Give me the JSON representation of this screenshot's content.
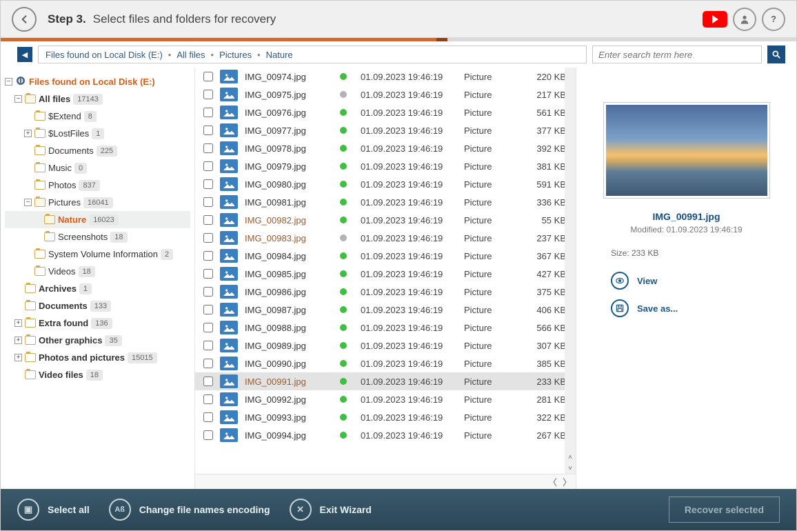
{
  "header": {
    "step": "Step 3.",
    "desc": "Select files and folders for recovery"
  },
  "breadcrumb": [
    "Files found on Local Disk (E:)",
    "All files",
    "Pictures",
    "Nature"
  ],
  "search": {
    "placeholder": "Enter search term here"
  },
  "tree": [
    {
      "level": 0,
      "exp": "-",
      "label": "Files found on Local Disk (E:)",
      "root": true,
      "icon": "disk"
    },
    {
      "level": 1,
      "exp": "-",
      "label": "All files",
      "bold": true,
      "count": "17143"
    },
    {
      "level": 2,
      "exp": "",
      "label": "$Extend",
      "count": "8"
    },
    {
      "level": 2,
      "exp": "+",
      "label": "$LostFiles",
      "count": "1"
    },
    {
      "level": 2,
      "exp": "",
      "label": "Documents",
      "count": "225"
    },
    {
      "level": 2,
      "exp": "",
      "label": "Music",
      "count": "0"
    },
    {
      "level": 2,
      "exp": "",
      "label": "Photos",
      "count": "837"
    },
    {
      "level": 2,
      "exp": "-",
      "label": "Pictures",
      "count": "16041"
    },
    {
      "level": 3,
      "exp": "",
      "label": "Nature",
      "count": "16023",
      "sel": true
    },
    {
      "level": 3,
      "exp": "",
      "label": "Screenshots",
      "count": "18"
    },
    {
      "level": 2,
      "exp": "",
      "label": "System Volume Information",
      "count": "2"
    },
    {
      "level": 2,
      "exp": "",
      "label": "Videos",
      "count": "18"
    },
    {
      "level": 1,
      "exp": "",
      "label": "Archives",
      "bold": true,
      "count": "1"
    },
    {
      "level": 1,
      "exp": "",
      "label": "Documents",
      "bold": true,
      "count": "133"
    },
    {
      "level": 1,
      "exp": "+",
      "label": "Extra found",
      "bold": true,
      "count": "136"
    },
    {
      "level": 1,
      "exp": "+",
      "label": "Other graphics",
      "bold": true,
      "count": "35"
    },
    {
      "level": 1,
      "exp": "+",
      "label": "Photos and pictures",
      "bold": true,
      "count": "15015"
    },
    {
      "level": 1,
      "exp": "",
      "label": "Video files",
      "bold": true,
      "count": "18"
    }
  ],
  "files": [
    {
      "name": "IMG_00974.jpg",
      "date": "01.09.2023 19:46:19",
      "type": "Picture",
      "size": "220 KB",
      "status": "green"
    },
    {
      "name": "IMG_00975.jpg",
      "date": "01.09.2023 19:46:19",
      "type": "Picture",
      "size": "217 KB",
      "status": "gray"
    },
    {
      "name": "IMG_00976.jpg",
      "date": "01.09.2023 19:46:19",
      "type": "Picture",
      "size": "561 KB",
      "status": "green"
    },
    {
      "name": "IMG_00977.jpg",
      "date": "01.09.2023 19:46:19",
      "type": "Picture",
      "size": "377 KB",
      "status": "green"
    },
    {
      "name": "IMG_00978.jpg",
      "date": "01.09.2023 19:46:19",
      "type": "Picture",
      "size": "392 KB",
      "status": "green"
    },
    {
      "name": "IMG_00979.jpg",
      "date": "01.09.2023 19:46:19",
      "type": "Picture",
      "size": "381 KB",
      "status": "green"
    },
    {
      "name": "IMG_00980.jpg",
      "date": "01.09.2023 19:46:19",
      "type": "Picture",
      "size": "591 KB",
      "status": "green"
    },
    {
      "name": "IMG_00981.jpg",
      "date": "01.09.2023 19:46:19",
      "type": "Picture",
      "size": "336 KB",
      "status": "green"
    },
    {
      "name": "IMG_00982.jpg",
      "date": "01.09.2023 19:46:19",
      "type": "Picture",
      "size": "55 KB",
      "status": "green",
      "brown": true
    },
    {
      "name": "IMG_00983.jpg",
      "date": "01.09.2023 19:46:19",
      "type": "Picture",
      "size": "237 KB",
      "status": "gray",
      "brown": true
    },
    {
      "name": "IMG_00984.jpg",
      "date": "01.09.2023 19:46:19",
      "type": "Picture",
      "size": "367 KB",
      "status": "green"
    },
    {
      "name": "IMG_00985.jpg",
      "date": "01.09.2023 19:46:19",
      "type": "Picture",
      "size": "427 KB",
      "status": "green"
    },
    {
      "name": "IMG_00986.jpg",
      "date": "01.09.2023 19:46:19",
      "type": "Picture",
      "size": "375 KB",
      "status": "green"
    },
    {
      "name": "IMG_00987.jpg",
      "date": "01.09.2023 19:46:19",
      "type": "Picture",
      "size": "406 KB",
      "status": "green"
    },
    {
      "name": "IMG_00988.jpg",
      "date": "01.09.2023 19:46:19",
      "type": "Picture",
      "size": "566 KB",
      "status": "green"
    },
    {
      "name": "IMG_00989.jpg",
      "date": "01.09.2023 19:46:19",
      "type": "Picture",
      "size": "307 KB",
      "status": "green"
    },
    {
      "name": "IMG_00990.jpg",
      "date": "01.09.2023 19:46:19",
      "type": "Picture",
      "size": "385 KB",
      "status": "green"
    },
    {
      "name": "IMG_00991.jpg",
      "date": "01.09.2023 19:46:19",
      "type": "Picture",
      "size": "233 KB",
      "status": "green",
      "sel": true,
      "brown": true
    },
    {
      "name": "IMG_00992.jpg",
      "date": "01.09.2023 19:46:19",
      "type": "Picture",
      "size": "281 KB",
      "status": "green"
    },
    {
      "name": "IMG_00993.jpg",
      "date": "01.09.2023 19:46:19",
      "type": "Picture",
      "size": "322 KB",
      "status": "green"
    },
    {
      "name": "IMG_00994.jpg",
      "date": "01.09.2023 19:46:19",
      "type": "Picture",
      "size": "267 KB",
      "status": "green"
    }
  ],
  "preview": {
    "name": "IMG_00991.jpg",
    "modified": "Modified: 01.09.2023 19:46:19",
    "size": "Size: 233 KB",
    "view": "View",
    "saveas": "Save as..."
  },
  "footer": {
    "selectall": "Select all",
    "encoding": "Change file names encoding",
    "exit": "Exit Wizard",
    "recover": "Recover selected"
  }
}
